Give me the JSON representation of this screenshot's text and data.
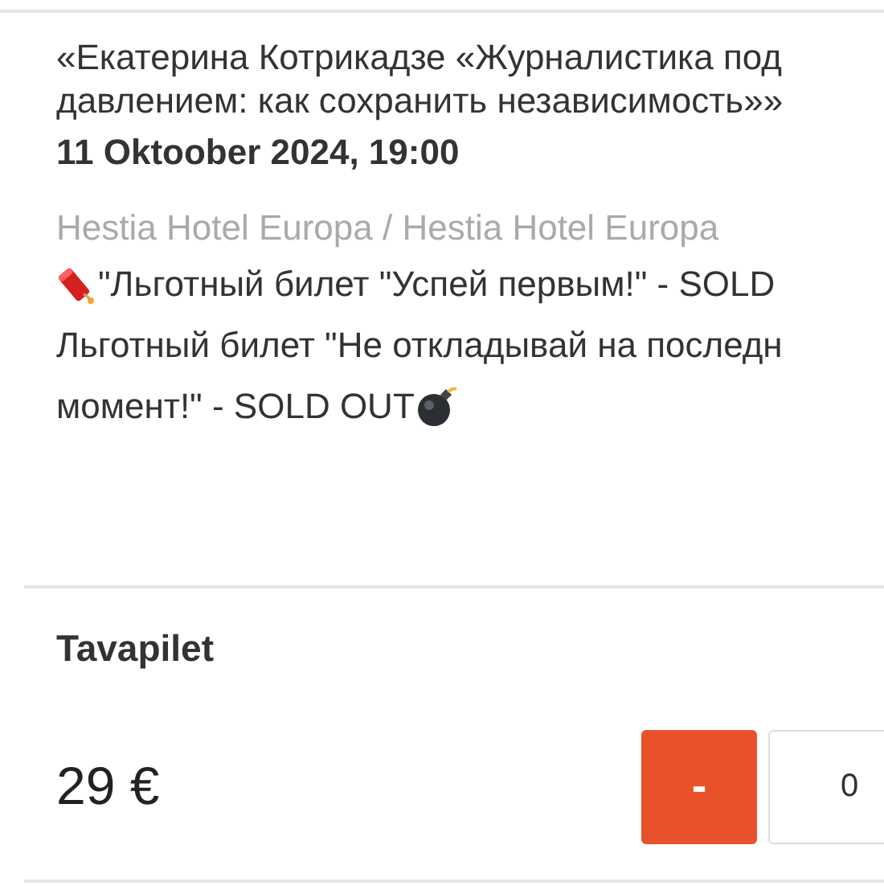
{
  "event": {
    "title_lines": [
      "«Екатерина Котрикадзе «Журналистика под",
      "давлением: как сохранить независимость»»"
    ],
    "datetime": "11 Oktoober 2024, 19:00",
    "venue": "Hestia Hotel Europa / Hestia Hotel Europa",
    "notes": [
      {
        "kind": "firecracker",
        "text": "\"Льготный билет \"Успей первым!\" - SOLD"
      },
      {
        "kind": "plain",
        "text": "Льготный билет \"Не откладывай на последн"
      },
      {
        "kind": "bomb",
        "text": "момент!\" - SOLD OUT"
      }
    ]
  },
  "ticket": {
    "name": "Tavapilet",
    "price": "29 €",
    "decrement": "-",
    "quantity": "0"
  }
}
